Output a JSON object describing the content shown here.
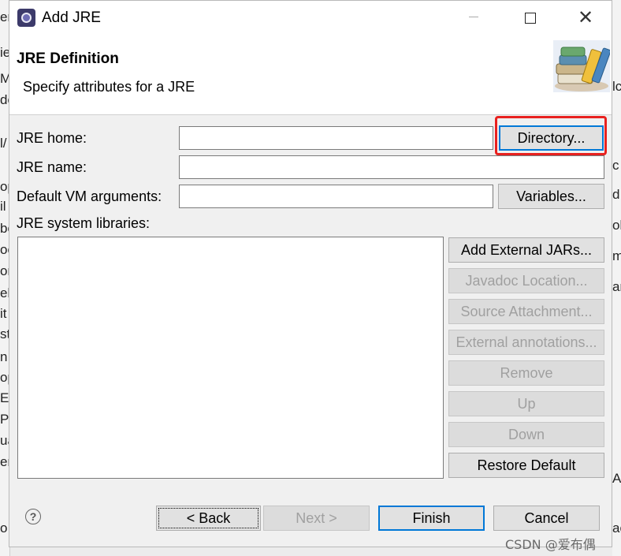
{
  "window": {
    "title": "Add JRE",
    "minimize_icon": "minimize-icon",
    "maximize_icon": "maximize-icon",
    "close_glyph": "✕"
  },
  "header": {
    "title": "JRE Definition",
    "description": "Specify attributes for a JRE",
    "art_icon": "jre-library-books-icon"
  },
  "form": {
    "jre_home_label": "JRE home:",
    "jre_home_value": "",
    "jre_name_label": "JRE name:",
    "jre_name_value": "",
    "vm_args_label": "Default VM arguments:",
    "vm_args_value": "",
    "libraries_label": "JRE system libraries:"
  },
  "buttons": {
    "directory": "Directory...",
    "variables": "Variables...",
    "add_external_jars": "Add External JARs...",
    "javadoc_location": "Javadoc Location...",
    "source_attachment": "Source Attachment...",
    "external_annotations": "External annotations...",
    "remove": "Remove",
    "up": "Up",
    "down": "Down",
    "restore_default": "Restore Default",
    "back": "< Back",
    "next": "Next >",
    "finish": "Finish",
    "cancel": "Cancel",
    "help": "?"
  },
  "background_fragments": {
    "left": [
      "er",
      "ier",
      "M",
      "de",
      "l/",
      "op",
      "il",
      "bo",
      "oc",
      "on",
      "eb",
      "it",
      "st",
      "n",
      "op",
      "E",
      "Pe",
      "ua",
      "er",
      "o"
    ],
    "right": [
      "lc",
      "c",
      "d",
      "oli",
      "m",
      "ar",
      "Ap",
      "ac"
    ]
  },
  "watermark": "CSDN @爱布偶",
  "colors": {
    "highlight": "#e8211f",
    "focus": "#0078d7"
  }
}
